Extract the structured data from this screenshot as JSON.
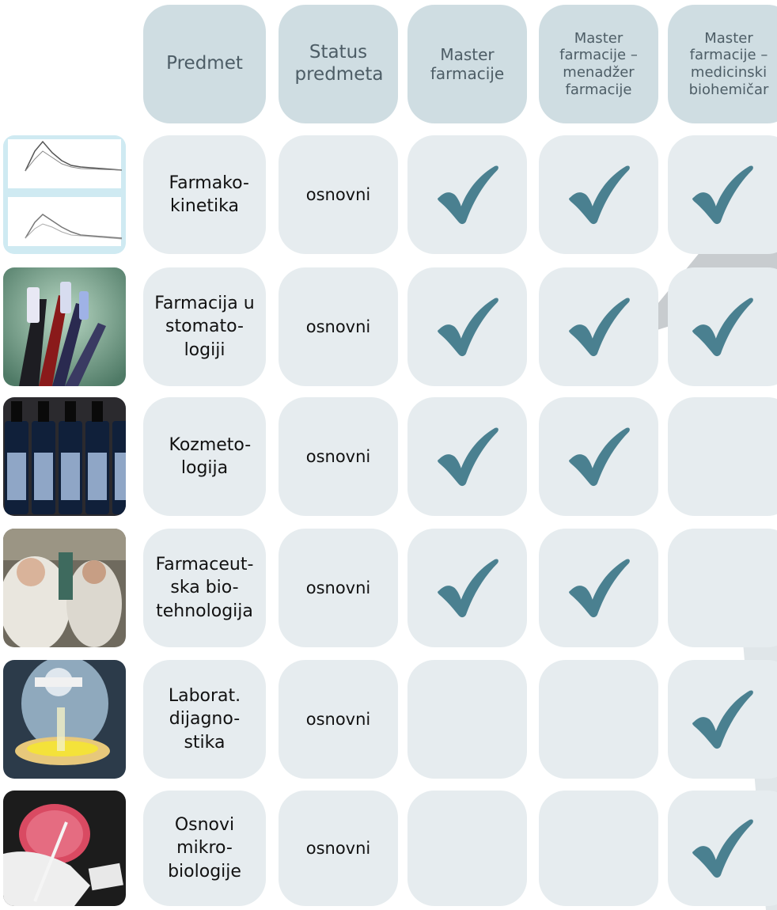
{
  "header": {
    "predmet": "Predmet",
    "status": "Status predmeta",
    "program1": "Master farmacije",
    "program2": "Master farmacije – menadžer farmacije",
    "program3": "Master farmacije – medicinski biohemičar"
  },
  "rows": [
    {
      "subject": "Farmako-kinetika",
      "status": "osnovni",
      "program1": true,
      "program2": true,
      "program3": true,
      "image": "pharmacokinetics-graph-image"
    },
    {
      "subject": "Farmacija u stomato-logiji",
      "status": "osnovni",
      "program1": true,
      "program2": true,
      "program3": true,
      "image": "toothbrushes-image"
    },
    {
      "subject": "Kozmeto-logija",
      "status": "osnovni",
      "program1": true,
      "program2": true,
      "program3": false,
      "image": "cosmetic-bottles-image"
    },
    {
      "subject": "Farmaceut-ska bio-tehnologija",
      "status": "osnovni",
      "program1": true,
      "program2": true,
      "program3": false,
      "image": "laboratory-workers-image"
    },
    {
      "subject": "Laborat. dijagno-stika",
      "status": "osnovni",
      "program1": false,
      "program2": false,
      "program3": true,
      "image": "lab-technician-flask-image"
    },
    {
      "subject": "Osnovi mikro-biologije",
      "status": "osnovni",
      "program1": false,
      "program2": false,
      "program3": true,
      "image": "petri-dish-image"
    }
  ],
  "colors": {
    "cell": "#e6ecef",
    "header_cell": "#cfdde2",
    "check": "#4a8090"
  },
  "icons": {
    "check": "check-icon"
  }
}
